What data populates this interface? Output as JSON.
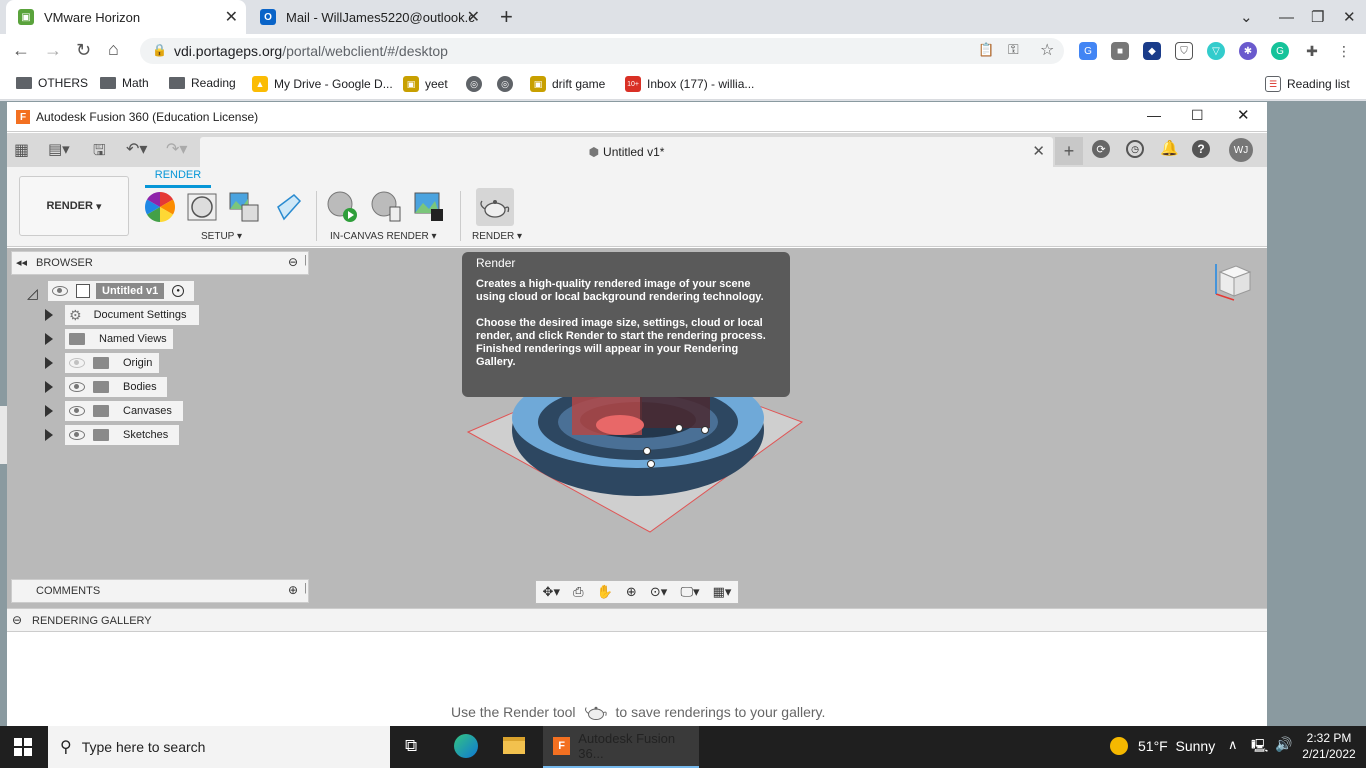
{
  "browser": {
    "tabs": [
      {
        "title": "VMware Horizon",
        "active": true
      },
      {
        "title": "Mail - WillJames5220@outlook.c",
        "active": false
      }
    ],
    "url_host": "vdi.portageps.org",
    "url_path": "/portal/webclient/#/desktop",
    "bookmarks": [
      "OTHERS",
      "Math",
      "Reading",
      "My Drive - Google D...",
      "yeet",
      "drift game",
      "Inbox (177) - willia..."
    ],
    "reading_list": "Reading list",
    "inbox_badge": "10+"
  },
  "fusion": {
    "window_title": "Autodesk Fusion 360 (Education License)",
    "doc_title": "Untitled v1*",
    "user_initials": "WJ",
    "workspace": "RENDER",
    "ribbon_tab": "RENDER",
    "groups": {
      "setup": "SETUP",
      "incanvas": "IN-CANVAS RENDER",
      "render": "RENDER"
    },
    "browser_panel": {
      "title": "BROWSER",
      "root": "Untitled v1",
      "items": [
        "Document Settings",
        "Named Views",
        "Origin",
        "Bodies",
        "Canvases",
        "Sketches"
      ]
    },
    "comments_title": "COMMENTS",
    "gallery_title": "RENDERING GALLERY",
    "gallery_hint_before": "Use the Render tool",
    "gallery_hint_after": "to save renderings to your gallery.",
    "tooltip": {
      "title": "Render",
      "para1": "Creates a high-quality rendered image of your scene using cloud or local background rendering technology.",
      "para2": "Choose the desired image size, settings, cloud or local render, and click Render to start the rendering process. Finished renderings will appear in your Rendering Gallery."
    }
  },
  "taskbar": {
    "search_placeholder": "Type here to search",
    "active_app": "Autodesk Fusion 36...",
    "weather_temp": "51°F",
    "weather_desc": "Sunny",
    "time": "2:32 PM",
    "date": "2/21/2022"
  }
}
